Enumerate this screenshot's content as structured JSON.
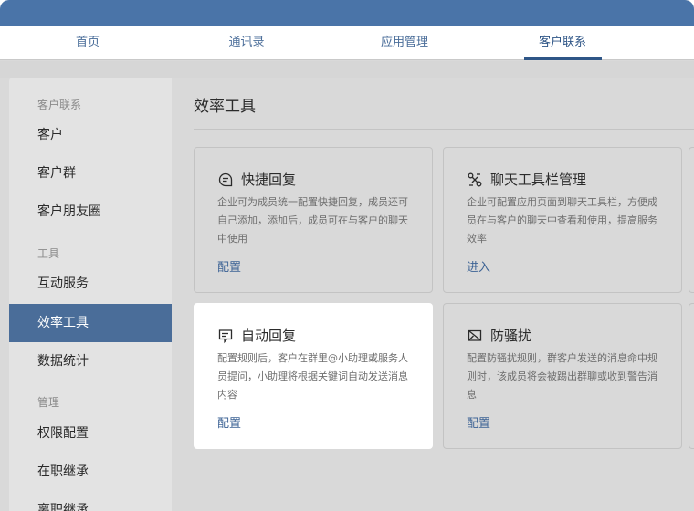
{
  "topnav": {
    "tabs": [
      {
        "label": "首页"
      },
      {
        "label": "通讯录"
      },
      {
        "label": "应用管理"
      },
      {
        "label": "客户联系",
        "active": true
      }
    ]
  },
  "sidebar": {
    "groups": {
      "customer": "客户联系",
      "tools": "工具",
      "manage": "管理"
    },
    "items": [
      {
        "label": "客户"
      },
      {
        "label": "客户群"
      },
      {
        "label": "客户朋友圈"
      },
      {
        "label": "互动服务"
      },
      {
        "label": "效率工具",
        "active": true
      },
      {
        "label": "数据统计"
      },
      {
        "label": "权限配置"
      },
      {
        "label": "在职继承"
      },
      {
        "label": "离职继承"
      }
    ]
  },
  "main": {
    "title": "效率工具",
    "cards": [
      {
        "icon": "quick-reply-icon",
        "title": "快捷回复",
        "desc": "企业可为成员统一配置快捷回复，成员还可自己添加，添加后，成员可在与客户的聊天中使用",
        "action": "配置"
      },
      {
        "icon": "chat-toolbar-icon",
        "title": "聊天工具栏管理",
        "desc": "企业可配置应用页面到聊天工具栏，方便成员在与客户的聊天中查看和使用，提高服务效率",
        "action": "进入"
      },
      {
        "icon": "auto-reply-icon",
        "title": "自动回复",
        "desc": "配置规则后，客户在群里@小助理或服务人员提问，小助理将根据关键词自动发送消息内容",
        "action": "配置"
      },
      {
        "icon": "anti-harassment-icon",
        "title": "防骚扰",
        "desc": "配置防骚扰规则，群客户发送的消息命中规则时，该成员将会被踢出群聊或收到警告消息",
        "action": "配置"
      }
    ]
  },
  "colors": {
    "accent": "#4a6d99",
    "titlebar": "#4a74a8",
    "link": "#3d6395"
  }
}
